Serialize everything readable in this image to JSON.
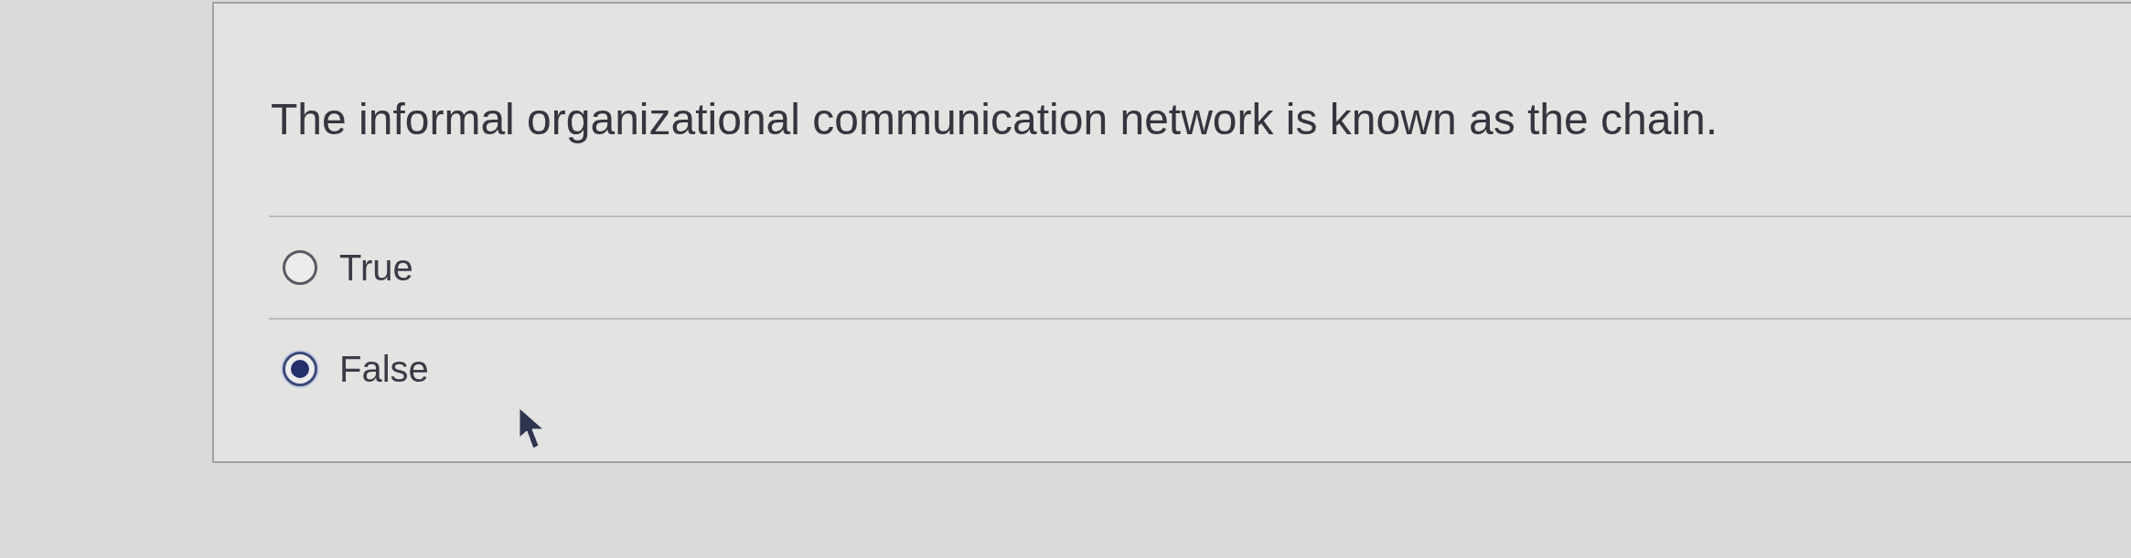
{
  "question": {
    "text": "The informal organizational communication network is known as the chain."
  },
  "options": [
    {
      "label": "True",
      "selected": false
    },
    {
      "label": "False",
      "selected": true
    }
  ]
}
